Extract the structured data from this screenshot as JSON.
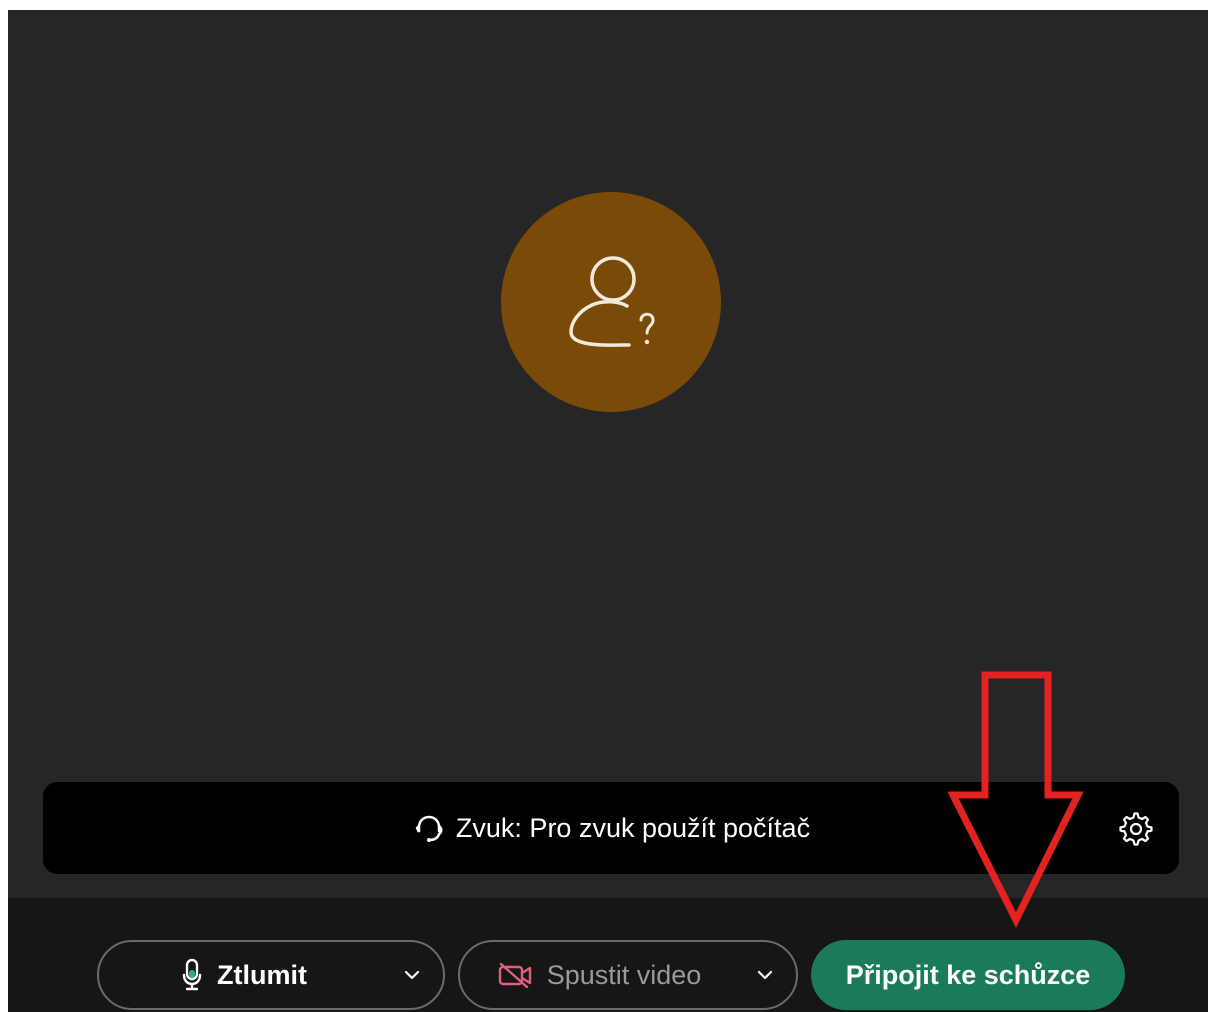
{
  "audio": {
    "label": "Zvuk: Pro zvuk použít počítač",
    "icon": "headset-icon",
    "settings_icon": "gear-icon"
  },
  "controls": {
    "mute_label": "Ztlumit",
    "video_label": "Spustit video",
    "join_label": "Připojit ke schůzce"
  },
  "colors": {
    "avatar_bg": "#7a4a08",
    "join_bg": "#1b7a58",
    "mic_accent": "#2bb37a",
    "video_off": "#e0607a",
    "annotation_arrow": "#e32222"
  },
  "avatar": {
    "icon": "unknown-user-icon"
  }
}
